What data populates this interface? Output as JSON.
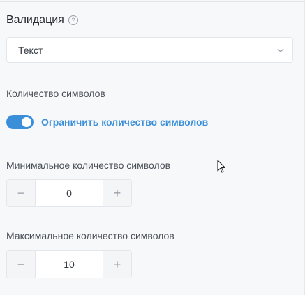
{
  "validation": {
    "title": "Валидация",
    "help_icon": "help-icon",
    "select_value": "Текст"
  },
  "char_count": {
    "section_label": "Количество символов",
    "toggle_label": "Ограничить количество символов",
    "toggle_on": true,
    "accent_color": "#3b8fd9"
  },
  "min_chars": {
    "label": "Минимальное количество символов",
    "minus": "−",
    "plus": "+",
    "value": "0"
  },
  "max_chars": {
    "label": "Максимальное количество символов",
    "minus": "−",
    "plus": "+",
    "value": "10"
  }
}
